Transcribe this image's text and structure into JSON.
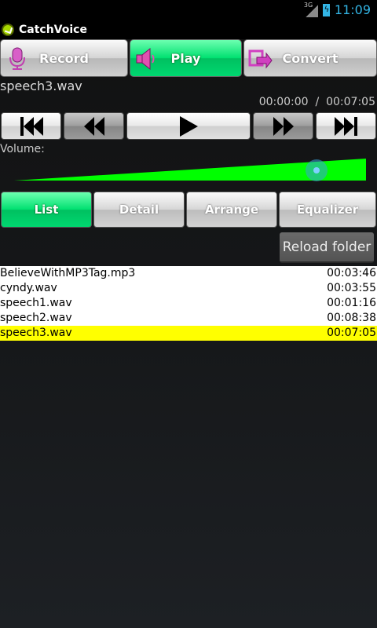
{
  "status_bar": {
    "network": "3G",
    "clock": "11:09"
  },
  "app": {
    "title": "CatchVoice"
  },
  "modes": [
    {
      "label": "Record",
      "icon": "microphone-icon",
      "active": false
    },
    {
      "label": "Play",
      "icon": "speaker-icon",
      "active": true
    },
    {
      "label": "Convert",
      "icon": "convert-arrow-icon",
      "active": false
    }
  ],
  "player": {
    "filename": "speech3.wav",
    "time_current": "00:00:00",
    "time_separator": "/",
    "time_total": "00:07:05"
  },
  "transport": {
    "buttons": [
      "skip-to-start-icon",
      "rewind-icon",
      "play-icon",
      "fast-forward-icon",
      "skip-to-end-icon"
    ]
  },
  "volume": {
    "label": "Volume:",
    "level": 0.86
  },
  "tabs": [
    {
      "label": "List",
      "active": true
    },
    {
      "label": "Detail",
      "active": false
    },
    {
      "label": "Arrange",
      "active": false
    },
    {
      "label": "Equalizer",
      "active": false
    }
  ],
  "reload_label": "Reload folder",
  "files": [
    {
      "name": "BelieveWithMP3Tag.mp3",
      "duration": "00:03:46",
      "selected": false
    },
    {
      "name": "cyndy.wav",
      "duration": "00:03:55",
      "selected": false
    },
    {
      "name": "speech1.wav",
      "duration": "00:01:16",
      "selected": false
    },
    {
      "name": "speech2.wav",
      "duration": "00:08:38",
      "selected": false
    },
    {
      "name": "speech3.wav",
      "duration": "00:07:05",
      "selected": true
    }
  ],
  "colors": {
    "accent_green": "#00e070",
    "volume_green": "#00ff00",
    "selection_yellow": "#ffff00",
    "clock_blue": "#33b5e5"
  }
}
